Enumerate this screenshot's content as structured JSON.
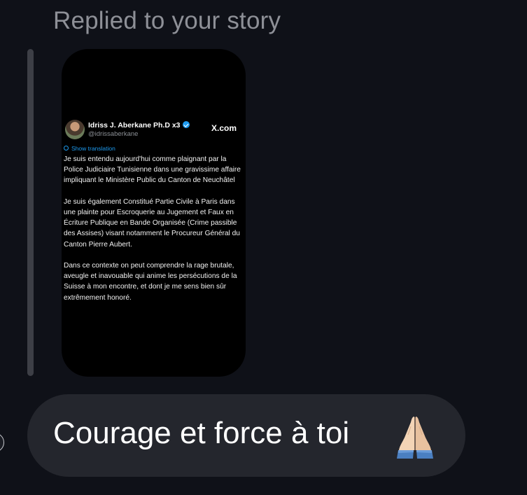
{
  "reply_label": "Replied to your story",
  "story": {
    "author_name": "Idriss J. Aberkane Ph.D x3",
    "author_handle": "@idrissaberkane",
    "site": "X.com",
    "translate_label": "Show translation",
    "paragraphs": [
      "Je suis entendu aujourd'hui comme plaignant par la Police Judiciaire Tunisienne dans une gravissime affaire impliquant le Ministère Public du Canton de Neuchâtel",
      "Je suis également Constitué Partie Civile à Paris dans une plainte pour Escroquerie au Jugement et Faux en Écriture Publique en Bande Organisée (Crime passible des Assises) visant notamment le Procureur Général du Canton Pierre Aubert.",
      "Dans ce contexte on peut comprendre la rage brutale, aveugle et inavouable qui anime les persécutions de la Suisse à mon encontre, et dont je me sens bien sûr extrêmement honoré."
    ]
  },
  "message": {
    "text": "Courage et force à toi",
    "emoji_icon": "praying-hands-icon"
  },
  "colors": {
    "background": "#0f1118",
    "bubble": "#24262d",
    "label": "#8e9097",
    "link": "#1d9bf0"
  }
}
